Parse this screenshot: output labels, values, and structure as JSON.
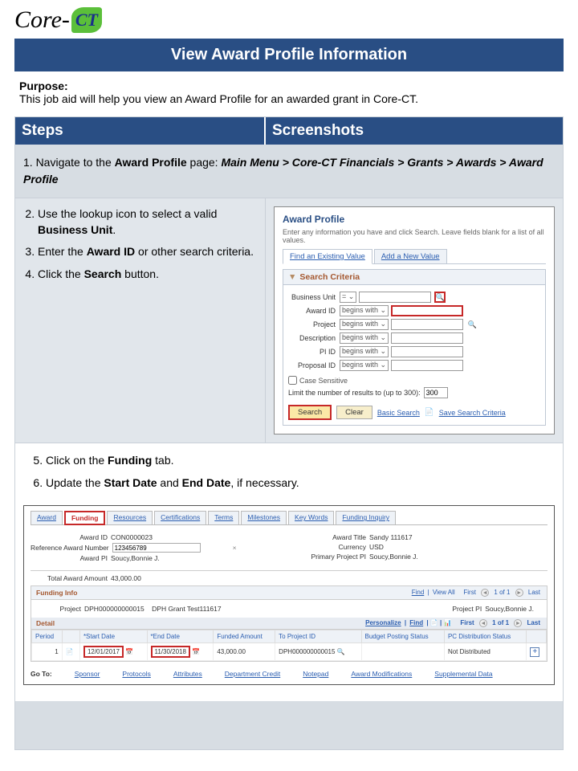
{
  "logo": {
    "text_left": "Core-",
    "text_right": "CT"
  },
  "title": "View Award Profile Information",
  "purpose": {
    "label": "Purpose:",
    "text": "This job aid will help you view an Award Profile for an awarded grant in Core-CT."
  },
  "headers": {
    "steps": "Steps",
    "screenshots": "Screenshots"
  },
  "nav_step": {
    "prefix": "1. Navigate to the ",
    "bold1": "Award Profile",
    "mid": " page: ",
    "path": "Main Menu > Core-CT Financials > Grants > Awards > Award Profile"
  },
  "steps_block1": {
    "s2a": "Use the lookup icon to select a valid ",
    "s2b": "Business Unit",
    "s2c": ".",
    "s3a": "Enter the ",
    "s3b": "Award ID",
    "s3c": " or other search criteria.",
    "s4a": "Click the ",
    "s4b": "Search",
    "s4c": " button."
  },
  "screenshot1": {
    "title": "Award Profile",
    "intro": "Enter any information you have and click Search. Leave fields blank for a list of all values.",
    "tab1": "Find an Existing Value",
    "tab2": "Add a New Value",
    "search_criteria": "Search Criteria",
    "fields": {
      "bu": "Business Unit",
      "award": "Award ID",
      "project": "Project",
      "desc": "Description",
      "pi": "PI ID",
      "proposal": "Proposal ID"
    },
    "op_eq": "=",
    "op_bw": "begins with",
    "case_sensitive": "Case Sensitive",
    "limit_label": "Limit the number of results to (up to 300):",
    "limit_value": "300",
    "btn_search": "Search",
    "btn_clear": "Clear",
    "link_basic": "Basic Search",
    "link_save": "Save Search Criteria"
  },
  "steps_block2": {
    "s5a": "Click on the ",
    "s5b": "Funding",
    "s5c": " tab.",
    "s6a": "Update the ",
    "s6b": "Start Date",
    "s6c": " and ",
    "s6d": "End Date",
    "s6e": ", if necessary."
  },
  "screenshot2": {
    "tabs": [
      "Award",
      "Funding",
      "Resources",
      "Certifications",
      "Terms",
      "Milestones",
      "Key Words",
      "Funding Inquiry"
    ],
    "info": {
      "award_id_l": "Award ID",
      "award_id_v": "CON0000023",
      "ref_l": "Reference Award Number",
      "ref_v": "123456789",
      "award_pi_l": "Award PI",
      "award_pi_v": "Soucy,Bonnie J.",
      "title_l": "Award Title",
      "title_v": "Sandy 111617",
      "currency_l": "Currency",
      "currency_v": "USD",
      "ppi_l": "Primary Project PI",
      "ppi_v": "Soucy,Bonnie J.",
      "total_l": "Total Award Amount",
      "total_v": "43,000.00"
    },
    "funding_info": "Funding Info",
    "nav": {
      "find": "Find",
      "viewall": "View All",
      "first": "First",
      "of": "1 of 1",
      "last": "Last"
    },
    "project_l": "Project",
    "project_v": "DPH000000000015",
    "project_desc": "DPH Grant Test111617",
    "project_pi_l": "Project PI",
    "project_pi_v": "Soucy,Bonnie J.",
    "detail": "Detail",
    "personalize": "Personalize",
    "find2": "Find",
    "cols": {
      "period": "Period",
      "start": "*Start Date",
      "end": "*End Date",
      "funded": "Funded Amount",
      "toproj": "To Project ID",
      "budget": "Budget Posting Status",
      "pc": "PC Distribution Status"
    },
    "row": {
      "period": "1",
      "start": "12/01/2017",
      "end": "11/30/2018",
      "funded": "43,000.00",
      "toproj": "DPH000000000015",
      "pc": "Not Distributed"
    },
    "goto": {
      "label": "Go To:",
      "links": [
        "Sponsor",
        "Protocols",
        "Attributes",
        "Department Credit",
        "Notepad",
        "Award Modifications",
        "Supplemental Data"
      ]
    }
  }
}
